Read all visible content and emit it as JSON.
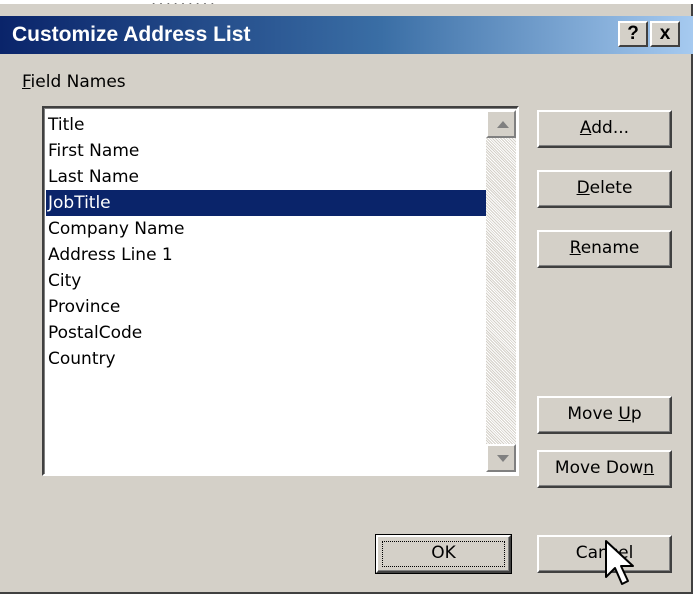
{
  "window": {
    "title": "Customize Address List",
    "help_button": "?",
    "close_button": "x"
  },
  "field_names_label": {
    "accel": "F",
    "rest": "ield Names"
  },
  "fields": [
    "Title",
    "First Name",
    "Last Name",
    "JobTitle",
    "Company Name",
    "Address Line 1",
    "City",
    "Province",
    "PostalCode",
    "Country"
  ],
  "selected_field": "JobTitle",
  "buttons": {
    "add": {
      "accel": "A",
      "rest": "dd..."
    },
    "delete": {
      "accel": "D",
      "rest": "elete"
    },
    "rename": {
      "accel": "R",
      "rest": "ename"
    },
    "move_up": {
      "pre": "Move ",
      "accel": "U",
      "rest": "p"
    },
    "move_down": {
      "pre": "Move Dow",
      "accel": "n",
      "rest": ""
    },
    "ok": "OK",
    "cancel": "Cancel"
  },
  "colors": {
    "title_gradient_start": "#0a246a",
    "title_gradient_end": "#a6caf0",
    "selection": "#0a246a",
    "face": "#d4d0c8"
  },
  "icons": {
    "scroll_up": "triangle-up",
    "scroll_down": "triangle-down",
    "pointer": "arrow-cursor"
  }
}
